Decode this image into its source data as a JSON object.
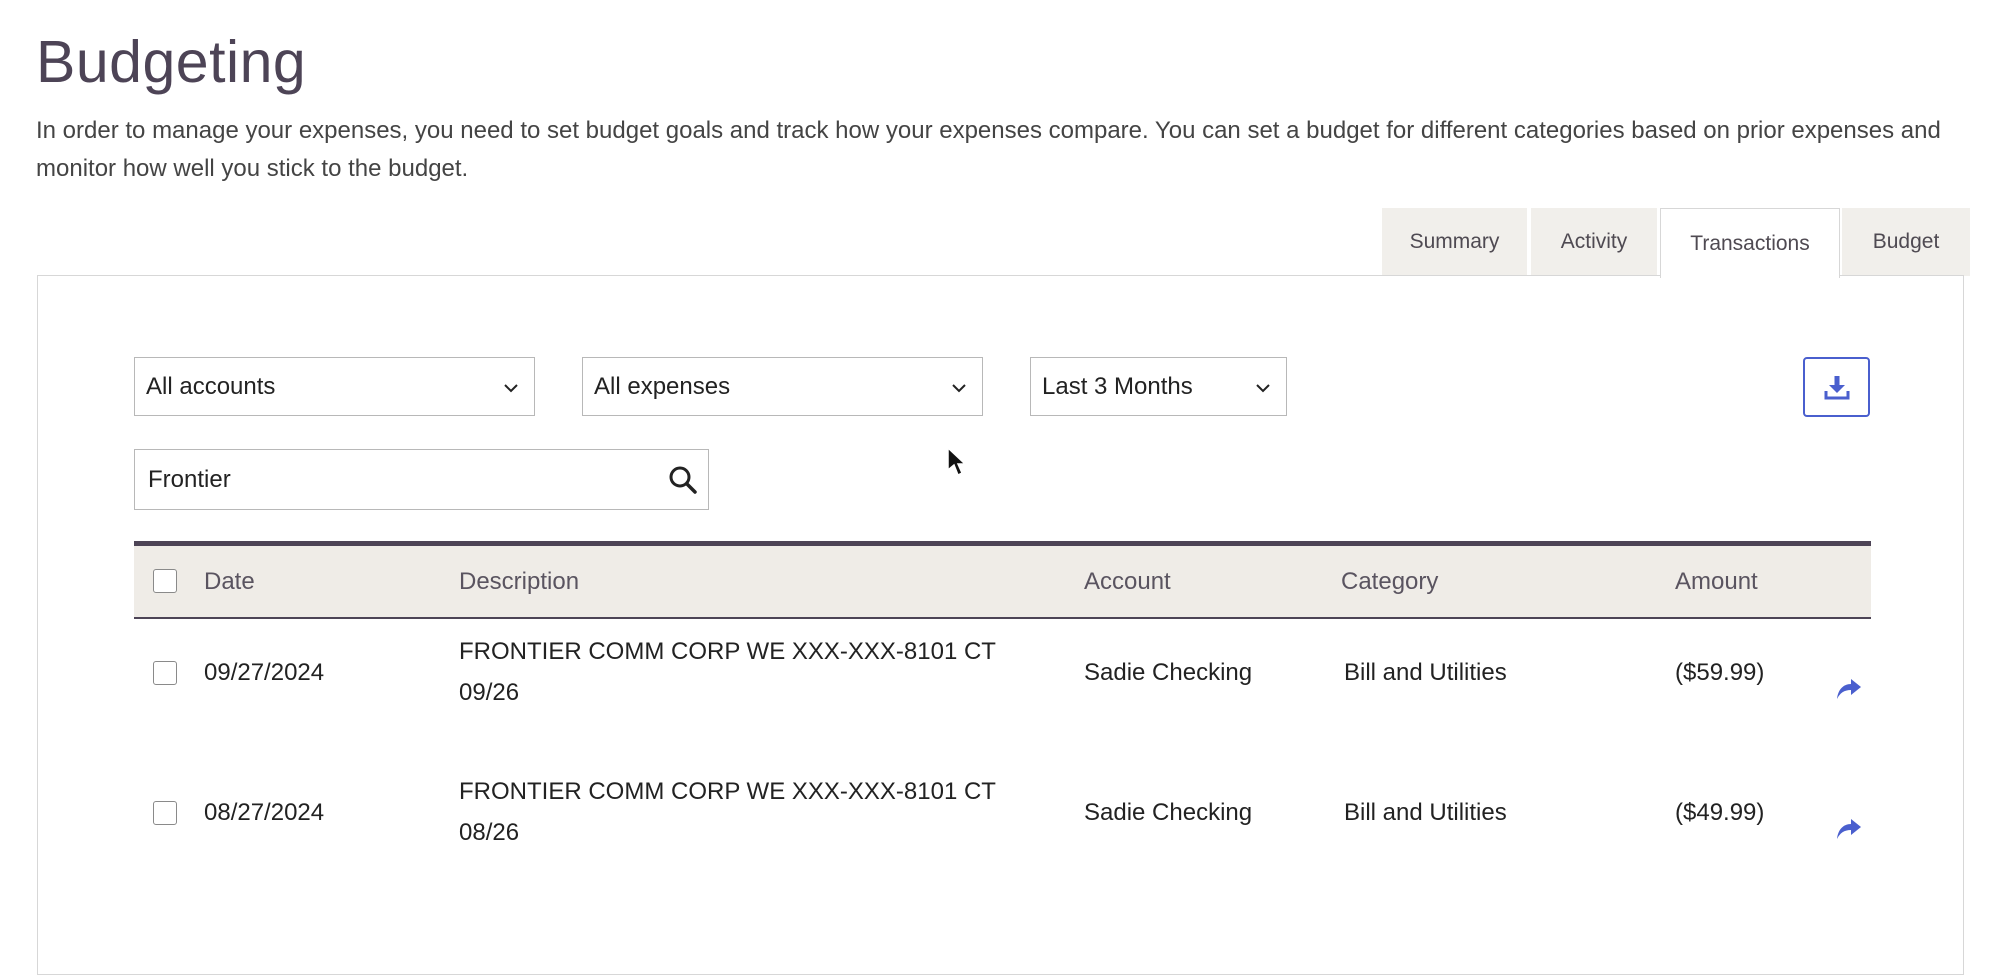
{
  "page": {
    "title": "Budgeting",
    "intro": "In order to manage your expenses, you need to set budget goals and track how your expenses compare. You can set a budget for different categories based on prior expenses and monitor how well you stick to the budget."
  },
  "tabs": [
    {
      "label": "Summary",
      "active": false
    },
    {
      "label": "Activity",
      "active": false
    },
    {
      "label": "Transactions",
      "active": true
    },
    {
      "label": "Budget",
      "active": false
    }
  ],
  "filters": {
    "accounts": "All accounts",
    "expenses": "All expenses",
    "period": "Last 3 Months"
  },
  "search": {
    "value": "Frontier"
  },
  "icons": {
    "download": "download-icon",
    "search": "search-icon",
    "share": "share-arrow-icon",
    "dropdown": "chevron-down-icon"
  },
  "colors": {
    "accent": "#4a5fce",
    "title": "#4d4456",
    "header_bg": "#efece7"
  },
  "table": {
    "headers": {
      "date": "Date",
      "description": "Description",
      "account": "Account",
      "category": "Category",
      "amount": "Amount"
    },
    "rows": [
      {
        "date": "09/27/2024",
        "description_line1": "FRONTIER COMM CORP WE XXX-XXX-8101 CT",
        "description_line2": "09/26",
        "account": "Sadie Checking",
        "category": "Bill and Utilities",
        "amount": "($59.99)"
      },
      {
        "date": "08/27/2024",
        "description_line1": "FRONTIER COMM CORP WE XXX-XXX-8101 CT",
        "description_line2": "08/26",
        "account": "Sadie Checking",
        "category": "Bill and Utilities",
        "amount": "($49.99)"
      }
    ]
  }
}
